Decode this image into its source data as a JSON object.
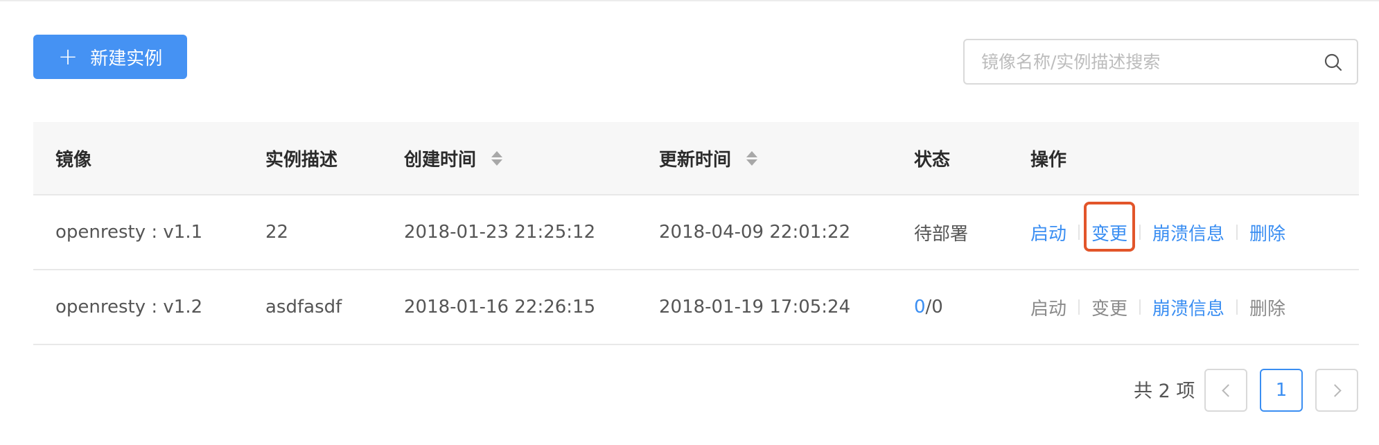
{
  "toolbar": {
    "new_button_label": "新建实例"
  },
  "search": {
    "placeholder": "镜像名称/实例描述搜索",
    "value": ""
  },
  "table": {
    "columns": [
      "镜像",
      "实例描述",
      "创建时间",
      "更新时间",
      "状态",
      "操作"
    ],
    "rows": [
      {
        "image": "openresty : v1.1",
        "description": "22",
        "created": "2018-01-23 21:25:12",
        "updated": "2018-04-09 22:01:22",
        "status": "待部署",
        "actions": [
          "启动",
          "变更",
          "崩溃信息",
          "删除"
        ]
      },
      {
        "image": "openresty : v1.2",
        "description": "asdfasdf",
        "created": "2018-01-16 22:26:15",
        "updated": "2018-01-19 17:05:24",
        "status_running": "0",
        "status_total": "/0",
        "actions": [
          "启动",
          "变更",
          "崩溃信息",
          "删除"
        ]
      }
    ]
  },
  "pagination": {
    "total_label": "共 2 项",
    "current_page": "1"
  },
  "colors": {
    "primary": "#4592f3",
    "link": "#3a8ef2",
    "highlight": "#e2552a"
  }
}
